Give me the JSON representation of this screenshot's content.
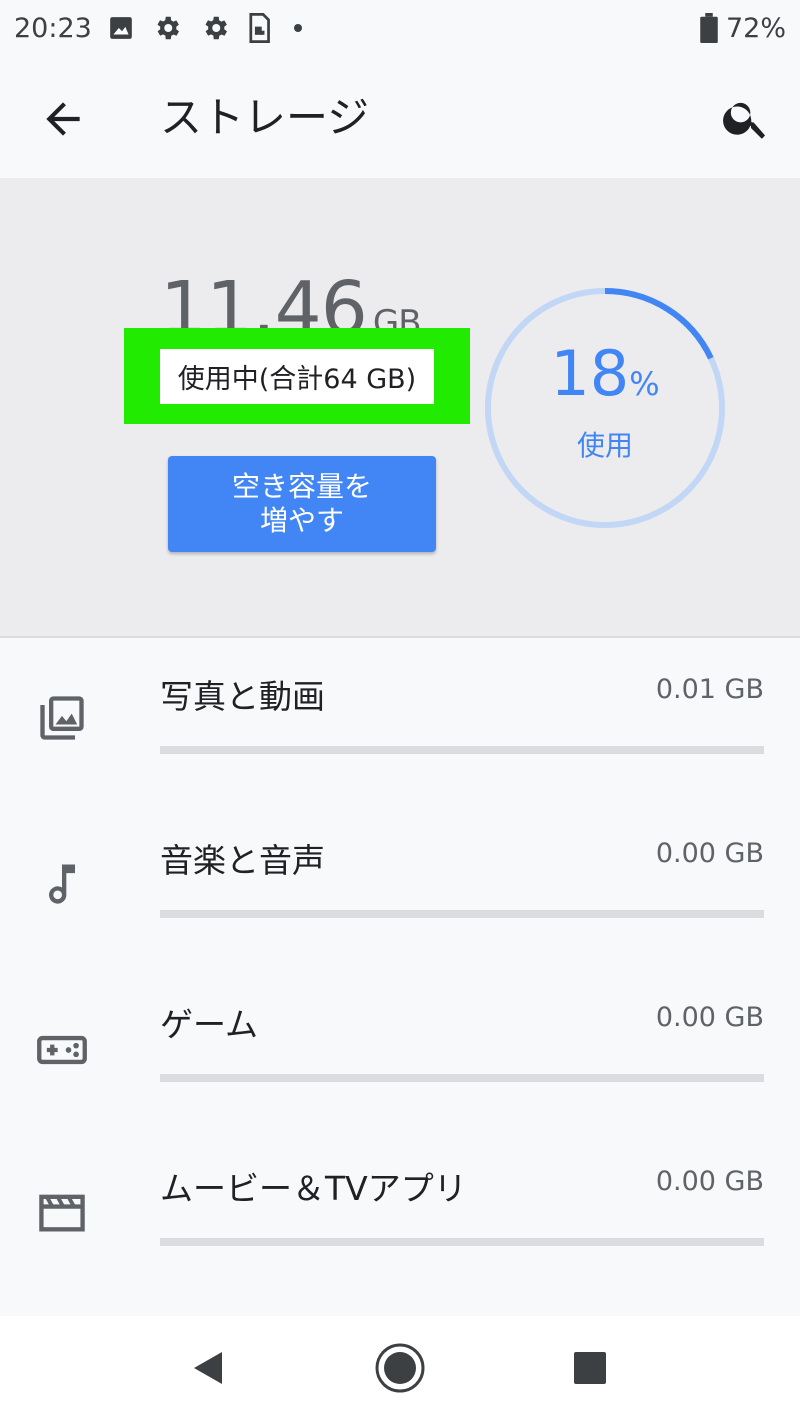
{
  "status_bar": {
    "time": "20:23",
    "icons": [
      "image-icon",
      "gear-icon",
      "gear-icon",
      "sim-card-icon",
      "dot-icon"
    ],
    "battery_percent": "72%"
  },
  "app_bar": {
    "title": "ストレージ",
    "back_icon": "arrow-back-icon",
    "search_icon": "search-icon"
  },
  "summary": {
    "used_value": "11.46",
    "used_unit": "GB",
    "used_caption": "使用中(合計64 GB)",
    "free_up_line1": "空き容量を",
    "free_up_line2": "増やす",
    "percent_value": "18",
    "percent_sign": "%",
    "percent_label": "使用",
    "percent_fraction": 0.18,
    "colors": {
      "accent": "#4285f4",
      "track": "#c2d6f6",
      "highlight": "#21ec00"
    }
  },
  "categories": [
    {
      "label": "写真と動画",
      "size": "0.01 GB",
      "icon": "photo-library-icon"
    },
    {
      "label": "音楽と音声",
      "size": "0.00 GB",
      "icon": "music-note-icon"
    },
    {
      "label": "ゲーム",
      "size": "0.00 GB",
      "icon": "gamepad-icon"
    },
    {
      "label": "ムービー＆TVアプリ",
      "size": "0.00 GB",
      "icon": "movie-icon"
    }
  ],
  "nav_bar": {
    "back_icon": "nav-back-icon",
    "home_icon": "nav-home-icon",
    "recents_icon": "nav-recents-icon"
  }
}
